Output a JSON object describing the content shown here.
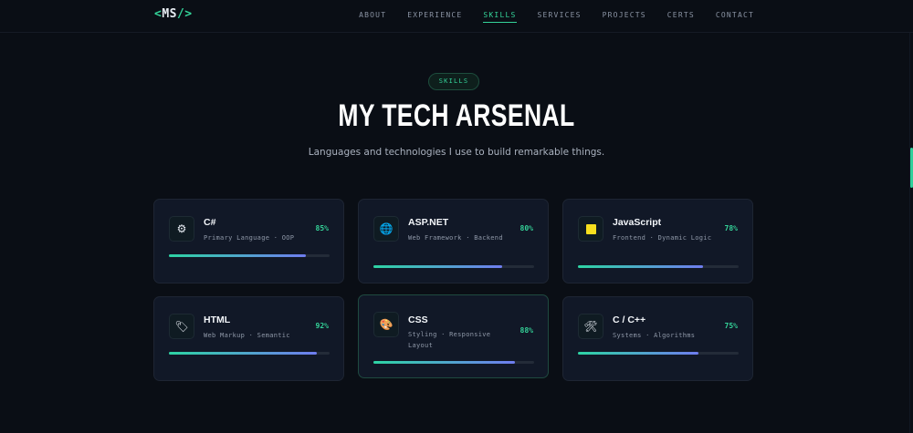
{
  "nav": {
    "logo": {
      "open": "<",
      "text": "MS",
      "close": "/>"
    },
    "links": [
      "ABOUT",
      "EXPERIENCE",
      "SKILLS",
      "SERVICES",
      "PROJECTS",
      "CERTS",
      "CONTACT"
    ],
    "active": "SKILLS"
  },
  "section": {
    "tag": "SKILLS",
    "title": "MY TECH ARSENAL",
    "subtitle": "Languages and technologies I use to build remarkable things."
  },
  "colors": {
    "accent": "#34d399",
    "bar_end": "#6f7df0",
    "background": "#0a0e15",
    "card": "#111827"
  },
  "skills": [
    {
      "name": "C#",
      "desc": "Primary Language · OOP",
      "pct_label": "85%",
      "level": 0.85,
      "icon": "gear-icon",
      "glyph": "⚙"
    },
    {
      "name": "ASP.NET",
      "desc": "Web Framework · Backend",
      "pct_label": "80%",
      "level": 0.8,
      "icon": "globe-icon",
      "glyph": "🌐"
    },
    {
      "name": "JavaScript",
      "desc": "Frontend · Dynamic Logic",
      "pct_label": "78%",
      "level": 0.78,
      "icon": "yellow-square-icon",
      "glyph": "🟨"
    },
    {
      "name": "HTML",
      "desc": "Web Markup · Semantic",
      "pct_label": "92%",
      "level": 0.92,
      "icon": "tag-icon",
      "glyph": "🏷"
    },
    {
      "name": "CSS",
      "desc": "Styling · Responsive Layout",
      "pct_label": "88%",
      "level": 0.88,
      "icon": "palette-icon",
      "glyph": "🎨"
    },
    {
      "name": "C / C++",
      "desc": "Systems · Algorithms",
      "pct_label": "75%",
      "level": 0.75,
      "icon": "tools-icon",
      "glyph": "🛠"
    }
  ]
}
